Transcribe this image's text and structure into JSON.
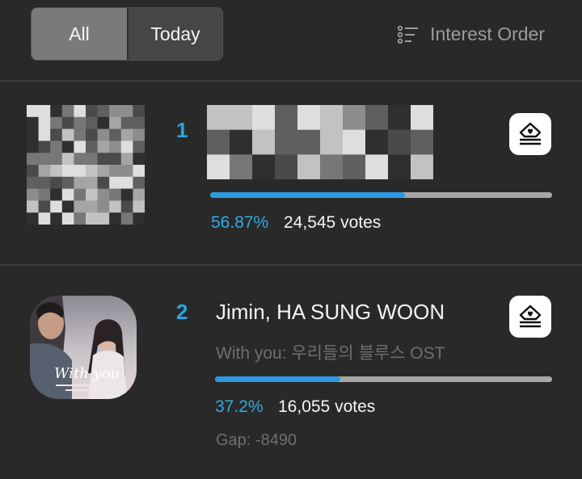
{
  "filter": {
    "tabs": [
      {
        "label": "All",
        "selected": true
      },
      {
        "label": "Today",
        "selected": false
      }
    ]
  },
  "sort": {
    "label": "Interest Order",
    "icon": "list-sort-icon"
  },
  "entries": [
    {
      "rank": "1",
      "title_obscured": true,
      "progress": 0.5687,
      "percent": "56.87%",
      "votes": "24,545 votes",
      "vote_icon": "vote-ballot-icon"
    },
    {
      "rank": "2",
      "artist": "Jimin, HA SUNG WOON",
      "song": "With you: 우리들의 블루스 OST",
      "progress": 0.372,
      "percent": "37.2%",
      "votes": "16,055 votes",
      "gap": "Gap: -8490",
      "vote_icon": "vote-ballot-icon"
    }
  ],
  "colors": {
    "accent": "#2a9ae0",
    "background": "#292929",
    "track": "#a7a7a7"
  }
}
